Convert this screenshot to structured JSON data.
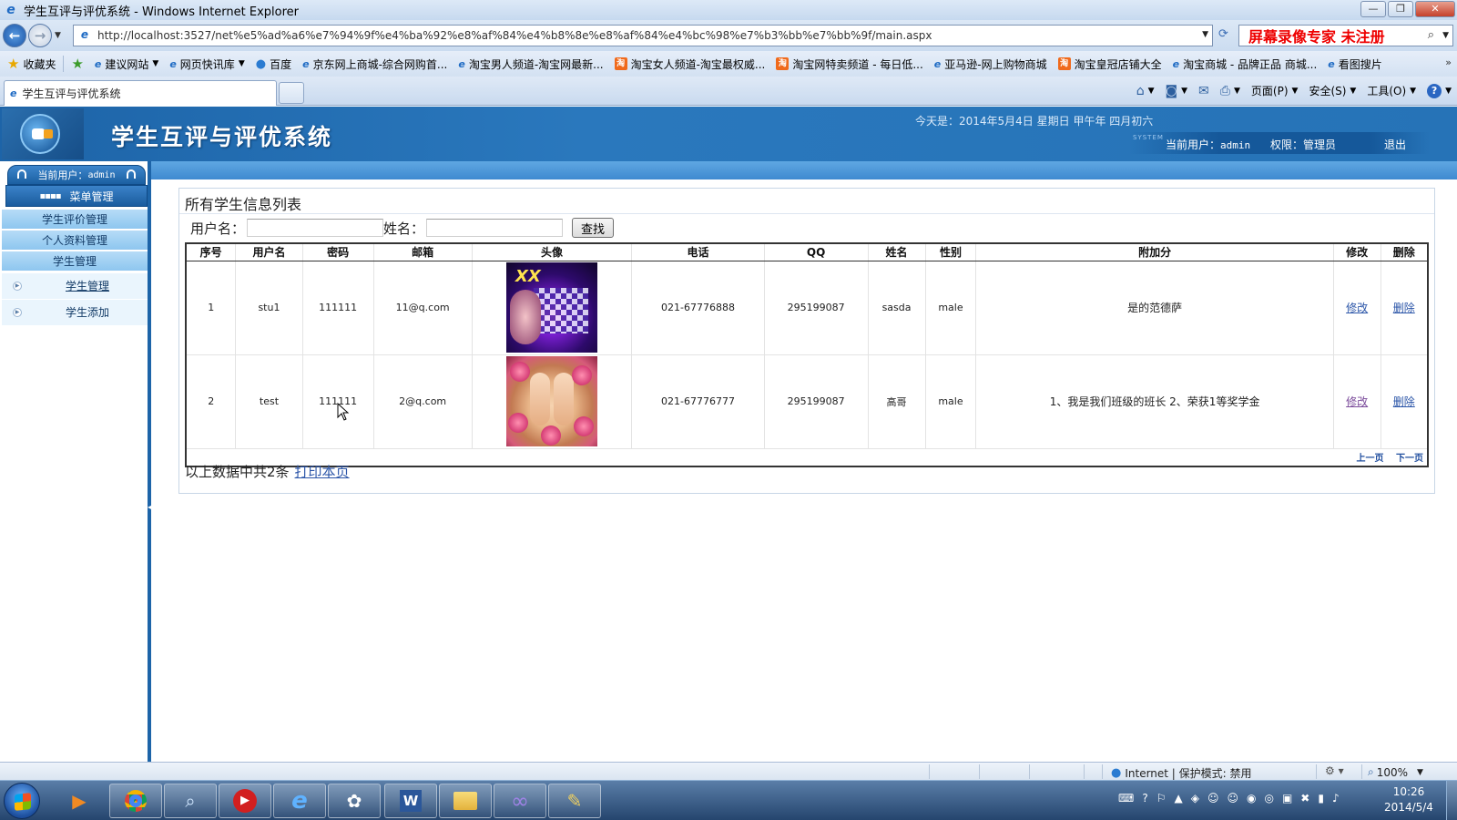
{
  "window": {
    "title": "学生互评与评优系统 - Windows Internet Explorer",
    "minimize": "—",
    "restore": "❐",
    "close": "✕"
  },
  "address_bar": {
    "url": "http://localhost:3527/net%e5%ad%a6%e7%94%9f%e4%ba%92%e8%af%84%e4%b8%8e%e8%af%84%e4%bc%98%e7%b3%bb%e7%bb%9f/main.aspx",
    "search_watermark": "屏幕录像专家 未注册"
  },
  "favorites_bar": {
    "favorites_label": "收藏夹",
    "items": [
      {
        "label": "建议网站",
        "icon": "ie-page-icon",
        "dropdown": true
      },
      {
        "label": "网页快讯库",
        "icon": "ie-page-icon",
        "dropdown": true
      },
      {
        "label": "百度",
        "icon": "globe-icon",
        "dropdown": false
      },
      {
        "label": "京东网上商城-综合网购首...",
        "icon": "ie-page-icon",
        "dropdown": false
      },
      {
        "label": "淘宝男人频道-淘宝网最新...",
        "icon": "ie-page-icon",
        "dropdown": false
      },
      {
        "label": "淘宝女人频道-淘宝最权威...",
        "icon": "taobao-icon",
        "dropdown": false
      },
      {
        "label": "淘宝网特卖频道 - 每日低...",
        "icon": "taobao-icon",
        "dropdown": false
      },
      {
        "label": "亚马逊-网上购物商城",
        "icon": "ie-page-icon",
        "dropdown": false
      },
      {
        "label": "淘宝皇冠店铺大全",
        "icon": "taobao-icon",
        "dropdown": false
      },
      {
        "label": "淘宝商城 - 品牌正品 商城...",
        "icon": "ie-page-icon",
        "dropdown": false
      },
      {
        "label": "看图搜片",
        "icon": "ie-page-icon",
        "dropdown": false
      }
    ],
    "more": "»"
  },
  "tabs": {
    "active_tab": "学生互评与评优系统"
  },
  "command_bar": {
    "page": "页面(P)",
    "safety": "安全(S)",
    "tools": "工具(O)"
  },
  "app": {
    "title": "学生互评与评优系统",
    "date_line": "今天是：2014年5月4日  星期日  甲午年  四月初六",
    "system_badge": "SYSTEM",
    "current_user_label": "当前用户：",
    "current_user": "admin",
    "role_label": "权限：管理员",
    "logout": "退出"
  },
  "sidebar": {
    "user_box_label": "当前用户：",
    "user_box_name": "admin",
    "menu_title": "菜单管理",
    "menu_items": [
      "学生评价管理",
      "个人资料管理",
      "学生管理"
    ],
    "sub_items": [
      "学生管理",
      "学生添加"
    ]
  },
  "main": {
    "panel_title": "所有学生信息列表",
    "search": {
      "username_label": "用户名：",
      "username_value": "",
      "name_label": "姓名：",
      "name_value": "",
      "find_button": "查找"
    },
    "columns": [
      "序号",
      "用户名",
      "密码",
      "邮箱",
      "头像",
      "电话",
      "QQ",
      "姓名",
      "性别",
      "附加分",
      "修改",
      "删除"
    ],
    "rows": [
      {
        "index": "1",
        "username": "stu1",
        "password": "111111",
        "email": "11@q.com",
        "phone": "021-67776888",
        "qq": "295199087",
        "name": "sasda",
        "gender": "male",
        "bonus": "是的范德萨",
        "edit": "修改",
        "delete": "删除"
      },
      {
        "index": "2",
        "username": "test",
        "password": "111111",
        "email": "2@q.com",
        "phone": "021-67776777",
        "qq": "295199087",
        "name": "高哥",
        "gender": "male",
        "bonus": "1、我是我们班级的班长 2、荣获1等奖学金",
        "edit": "修改",
        "delete": "删除"
      }
    ],
    "pager": {
      "prev": "上一页",
      "next": "下一页"
    },
    "summary": "以上数据中共2条",
    "print_link": "打印本页"
  },
  "status_bar": {
    "zone": "Internet | 保护模式: 禁用",
    "zoom": "100%"
  },
  "taskbar": {
    "clock_time": "10:26",
    "clock_date": "2014/5/4"
  }
}
